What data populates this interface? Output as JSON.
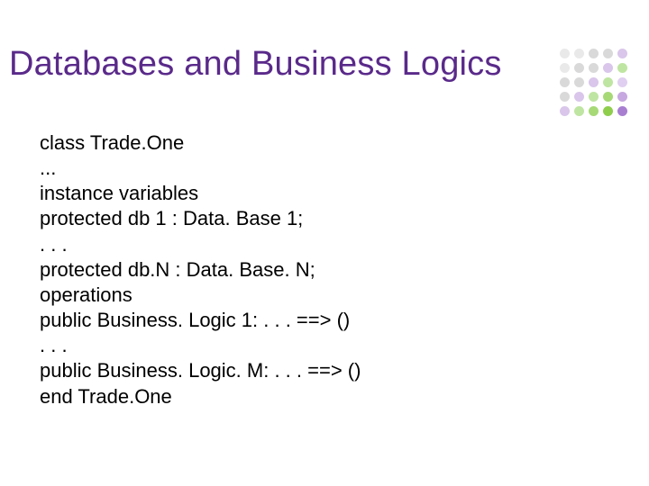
{
  "title": "Databases and Business Logics",
  "code": {
    "l0": "class Trade.One",
    "l1": "...",
    "l2": "instance variables",
    "l3": "protected db 1 : Data. Base 1;",
    "l4": ". . .",
    "l5": "protected db.N : Data. Base. N;",
    "l6": "operations",
    "l7": "public Business. Logic 1: . . . ==> ()",
    "l8": ". . .",
    "l9": "public Business. Logic. M: . . . ==> ()",
    "l10": "end Trade.One"
  },
  "decor": {
    "colors": {
      "c1": "#e9e9e9",
      "c2": "#d9d9d9",
      "c3": "#c9c9c9",
      "c4": "#bcbcbc",
      "c5": "#d9c6ea",
      "c6": "#bfe5a2",
      "c7": "#a7d977",
      "c8": "#8fce4d",
      "c9": "#e0cff0",
      "c10": "#c7a8e0",
      "c11": "#a87fd0"
    }
  }
}
